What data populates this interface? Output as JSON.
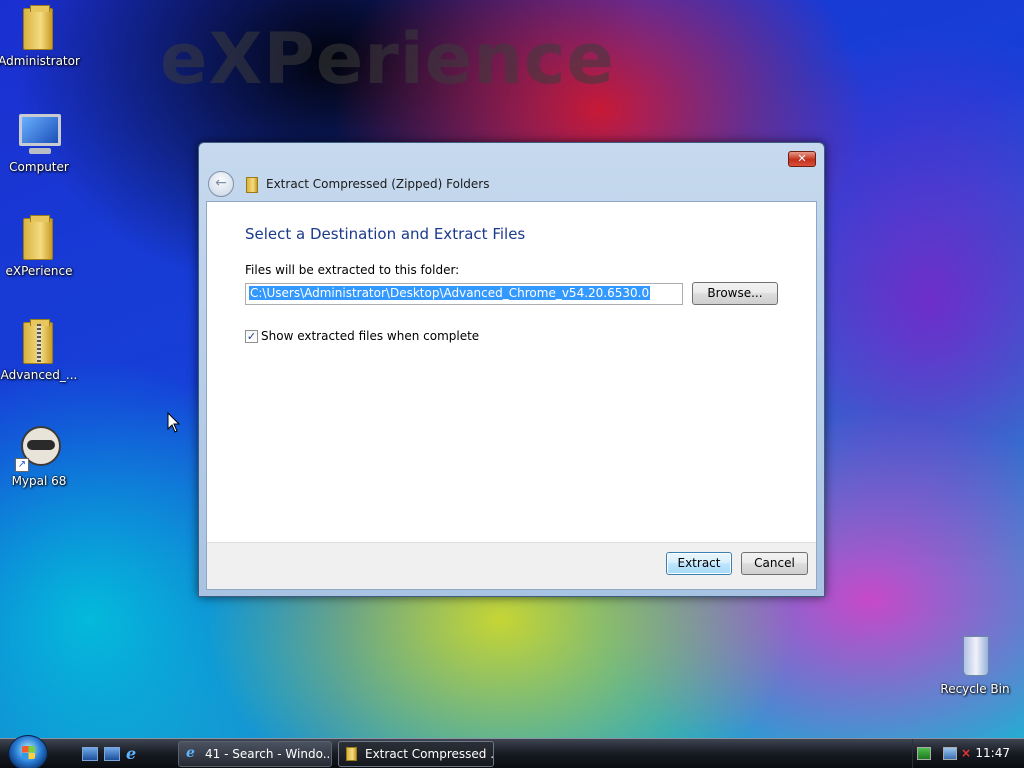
{
  "desktop": {
    "watermark": "eXPerience",
    "icons": [
      {
        "label": "Administrator",
        "icon": "folder-icon"
      },
      {
        "label": "Computer",
        "icon": "computer-icon"
      },
      {
        "label": "eXPerience",
        "icon": "folder-icon"
      },
      {
        "label": "Advanced_...",
        "icon": "zip-folder-icon"
      },
      {
        "label": "Mypal 68",
        "icon": "mypal-browser-icon"
      },
      {
        "label": "Recycle Bin",
        "icon": "recycle-bin-icon"
      }
    ]
  },
  "dialog": {
    "title": "Extract Compressed (Zipped) Folders",
    "close_glyph": "✕",
    "back_glyph": "←",
    "heading": "Select a Destination and Extract Files",
    "dest_label": "Files will be extracted to this folder:",
    "dest_path": "C:\\Users\\Administrator\\Desktop\\Advanced_Chrome_v54.20.6530.0",
    "browse_label": "Browse...",
    "show_files_label": "Show extracted files when complete",
    "show_files_checked": true,
    "check_glyph": "✓",
    "extract_label": "Extract",
    "cancel_label": "Cancel"
  },
  "taskbar": {
    "ie_glyph": "e",
    "tasks": [
      {
        "label": "41 - Search - Windo...",
        "icon": "internet-explorer-icon",
        "active": false
      },
      {
        "label": "Extract Compressed ...",
        "icon": "zip-folder-icon",
        "active": true
      }
    ],
    "clock": "11:47"
  },
  "colors": {
    "heading": "#1c3a8c",
    "selection": "#3399ff",
    "close_button": "#c3301c"
  }
}
